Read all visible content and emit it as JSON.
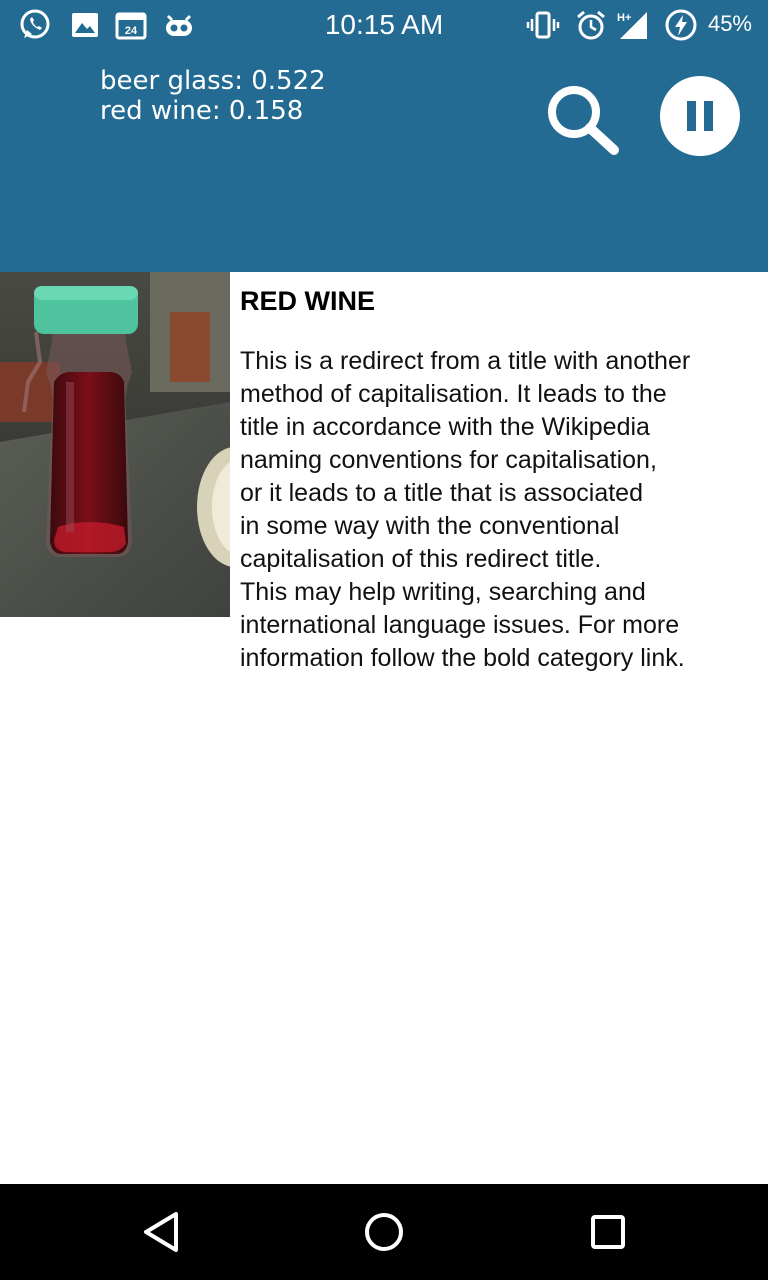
{
  "status_bar": {
    "time": "10:15 AM",
    "battery_percent": "45%",
    "calendar_day": "24",
    "network_type": "H+",
    "left_icons": [
      "whatsapp-icon",
      "gallery-icon",
      "calendar-icon",
      "cyanogen-bot-icon"
    ],
    "right_icons": [
      "vibrate-icon",
      "alarm-icon",
      "signal-icon",
      "battery-charging-icon"
    ]
  },
  "app_bar": {
    "background_color": "#246b94",
    "predictions": [
      {
        "text": "beer glass: 0.522"
      },
      {
        "text": "red wine: 0.158"
      }
    ],
    "search_icon": "search-icon",
    "pause_icon": "pause-icon"
  },
  "article": {
    "title": "RED WINE",
    "lines": [
      "This is a redirect from a title with another",
      "method of capitalisation. It leads to the",
      "title in accordance with the Wikipedia",
      "naming conventions for capitalisation,",
      "or it leads to a title that is associated",
      "in some way with the conventional",
      "capitalisation of this redirect title.",
      "This may help writing, searching and",
      "international language issues. For more",
      "information follow the bold category link."
    ]
  },
  "nav_bar": {
    "buttons": [
      "back-icon",
      "home-icon",
      "recents-icon"
    ]
  }
}
